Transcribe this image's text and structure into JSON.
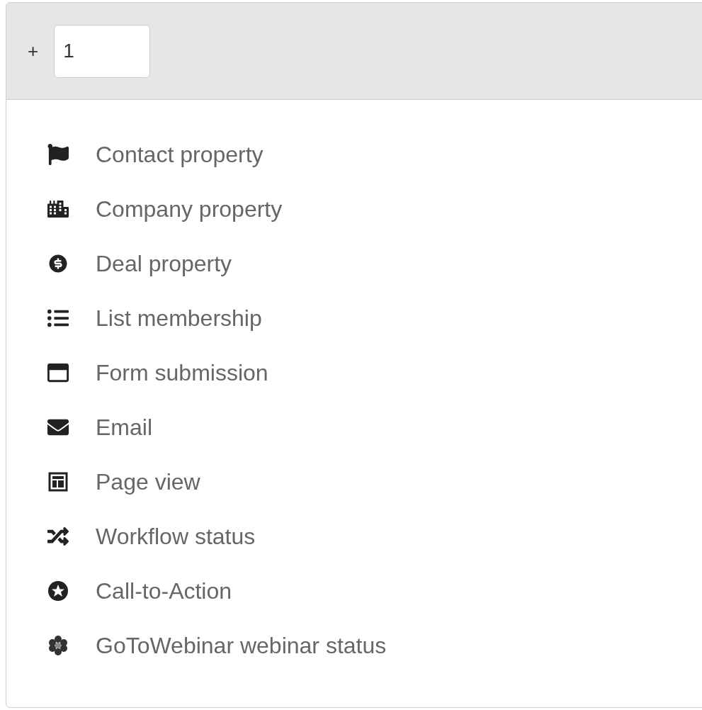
{
  "header": {
    "prefix": "+",
    "input_value": "1"
  },
  "options": [
    {
      "kind": "flag",
      "label": "Contact property"
    },
    {
      "kind": "buildings",
      "label": "Company property"
    },
    {
      "kind": "coin",
      "label": "Deal property"
    },
    {
      "kind": "list",
      "label": "List membership"
    },
    {
      "kind": "form",
      "label": "Form submission"
    },
    {
      "kind": "envelope",
      "label": "Email"
    },
    {
      "kind": "page",
      "label": "Page view"
    },
    {
      "kind": "shuffle",
      "label": "Workflow status"
    },
    {
      "kind": "star",
      "label": "Call-to-Action"
    },
    {
      "kind": "webinar",
      "label": "GoToWebinar webinar status"
    }
  ]
}
